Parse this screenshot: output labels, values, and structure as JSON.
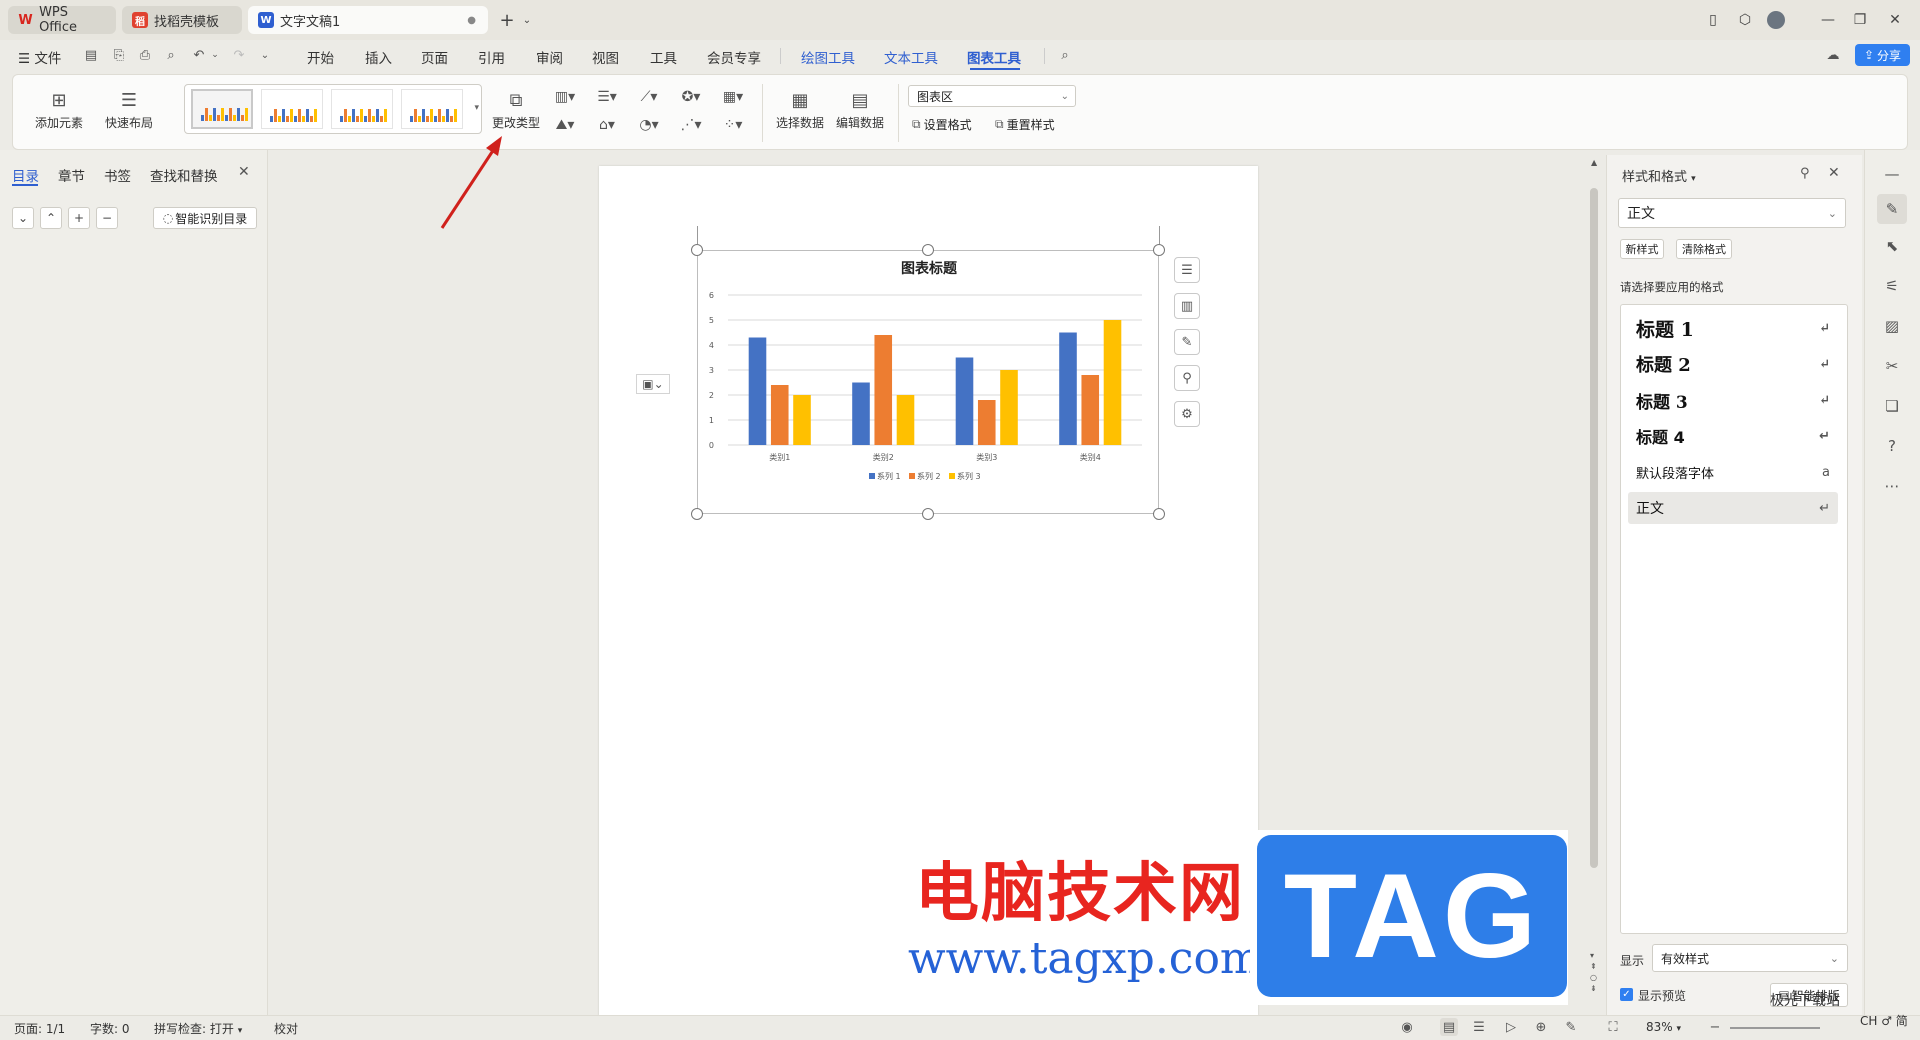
{
  "titlebar": {
    "tabs": [
      {
        "label": "WPS Office",
        "logo": "W"
      },
      {
        "label": "找稻壳模板",
        "logo": "稻"
      },
      {
        "label": "文字文稿1",
        "logo": "W"
      }
    ],
    "new_tab": "+"
  },
  "menubar": {
    "file": "文件",
    "items": [
      "开始",
      "插入",
      "页面",
      "引用",
      "审阅",
      "视图",
      "工具",
      "会员专享"
    ],
    "tool_tabs": [
      "绘图工具",
      "文本工具",
      "图表工具"
    ],
    "share": "分享"
  },
  "ribbon": {
    "add_element": "添加元素",
    "quick_layout": "快速布局",
    "change_type": "更改类型",
    "select_data": "选择数据",
    "edit_data": "编辑数据",
    "chart_area_select": "图表区",
    "set_format": "设置格式",
    "reset_style": "重置样式"
  },
  "leftpane": {
    "tabs": [
      "目录",
      "章节",
      "书签",
      "查找和替换"
    ],
    "smart_toc": "智能识别目录"
  },
  "chart_data": {
    "type": "bar",
    "title": "图表标题",
    "categories": [
      "类别1",
      "类别2",
      "类别3",
      "类别4"
    ],
    "series": [
      {
        "name": "系列 1",
        "values": [
          4.3,
          2.5,
          3.5,
          4.5
        ],
        "color": "#4472c4"
      },
      {
        "name": "系列 2",
        "values": [
          2.4,
          4.4,
          1.8,
          2.8
        ],
        "color": "#ed7d31"
      },
      {
        "name": "系列 3",
        "values": [
          2.0,
          2.0,
          3.0,
          5.0
        ],
        "color": "#ffc000"
      }
    ],
    "ylim": [
      0,
      6
    ],
    "yticks": [
      "0",
      "1",
      "2",
      "3",
      "4",
      "5",
      "6"
    ],
    "grid": true,
    "legend": "bottom"
  },
  "rightpane": {
    "title": "样式和格式",
    "current_style": "正文",
    "new_style": "新样式",
    "clear_format": "清除格式",
    "hint": "请选择要应用的格式",
    "styles": [
      {
        "label": "标题  1"
      },
      {
        "label": "标题  2"
      },
      {
        "label": "标题  3"
      },
      {
        "label": "标题  4"
      },
      {
        "label": "默认段落字体"
      },
      {
        "label": "正文"
      }
    ],
    "show_label": "显示",
    "show_value": "有效样式",
    "preview": "显示预览",
    "smart_layout": "智能排版"
  },
  "statusbar": {
    "page": "页面: 1/1",
    "words": "字数: 0",
    "spell": "拼写检查: 打开",
    "proof": "校对",
    "zoom": "83%"
  },
  "watermark": {
    "cn": "电脑技术网",
    "url": "www.tagxp.com",
    "tag": "TAG",
    "site": "极光下载站",
    "site2": "CH ♂ 简"
  },
  "colors": {
    "accent": "#2f5fd0",
    "arrow": "#d0211c"
  }
}
